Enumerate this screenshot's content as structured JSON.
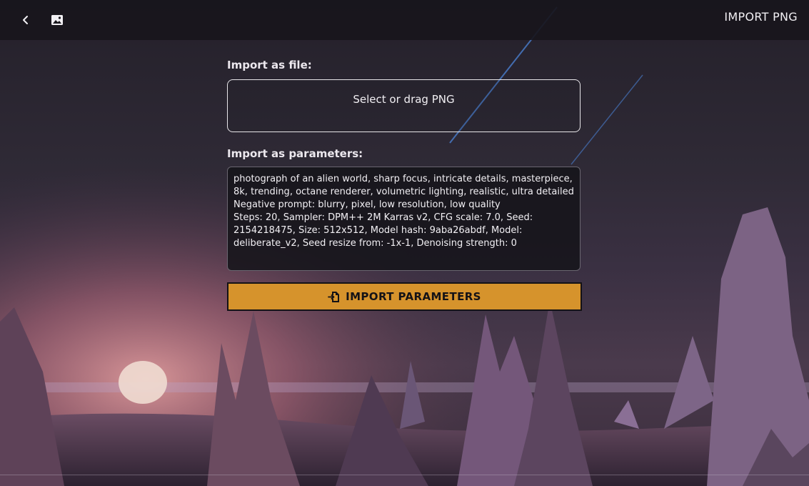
{
  "header": {
    "back_icon": "chevron-left-icon",
    "image_icon": "image-icon",
    "title": "IMPORT PNG"
  },
  "file_import": {
    "label": "Import as file:",
    "dropzone_text": "Select or drag PNG"
  },
  "params_import": {
    "label": "Import as parameters:",
    "value": "photograph of an alien world, sharp focus, intricate details, masterpiece, 8k, trending, octane renderer, volumetric lighting, realistic, ultra detailed\nNegative prompt: blurry, pixel, low resolution, low quality\nSteps: 20, Sampler: DPM++ 2M Karras v2, CFG scale: 7.0, Seed: 2154218475, Size: 512x512, Model hash: 9aba26abdf, Model: deliberate_v2, Seed resize from: -1x-1, Denoising strength: 0"
  },
  "import_button": {
    "label": "IMPORT PARAMETERS",
    "icon": "file-import-icon"
  },
  "colors": {
    "accent": "#d6932c",
    "topbar": "#18161c",
    "text": "#f2f0f4"
  }
}
